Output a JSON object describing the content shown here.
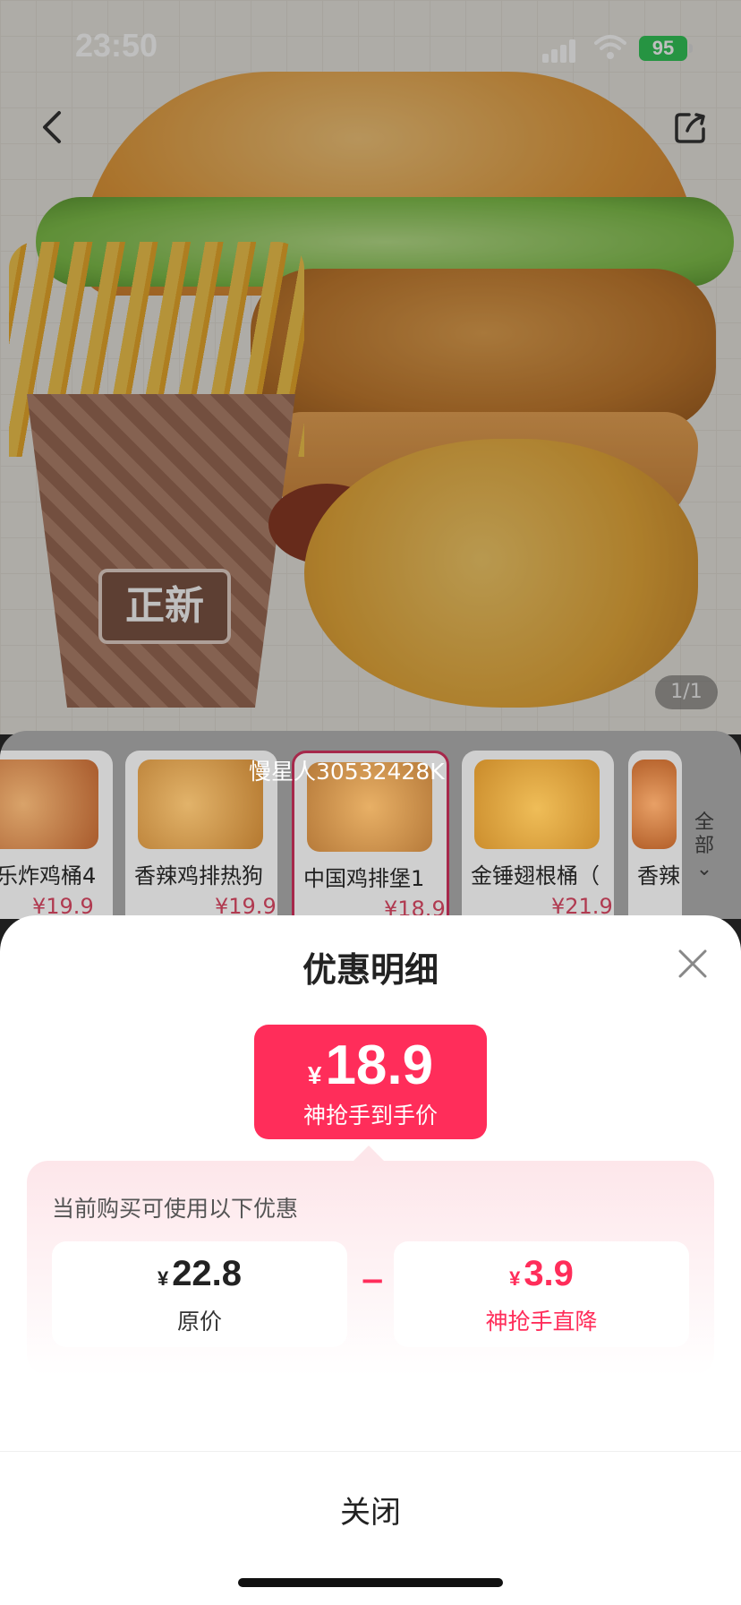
{
  "status": {
    "time": "23:50",
    "battery": "95"
  },
  "hero": {
    "pager": "1/1",
    "cup_brand": "正新"
  },
  "products": [
    {
      "name": "乐炸鸡桶4",
      "price": "¥19.9"
    },
    {
      "name": "香辣鸡排热狗",
      "price": "¥19.9"
    },
    {
      "name": "中国鸡排堡1",
      "price": "¥18.9"
    },
    {
      "name": "金锤翅根桶（",
      "price": "¥21.9"
    },
    {
      "name": "香辣",
      "price": ""
    }
  ],
  "all_button": "全部",
  "watermark": "慢星人30532428K",
  "sheet": {
    "title": "优惠明细",
    "final_price": {
      "currency": "¥",
      "value": "18.9",
      "label": "神抢手到手价"
    },
    "promo_label": "当前购买可使用以下优惠",
    "original": {
      "currency": "¥",
      "value": "22.8",
      "label": "原价"
    },
    "operator": "−",
    "discount": {
      "currency": "¥",
      "value": "3.9",
      "label": "神抢手直降"
    },
    "close_label": "关闭"
  },
  "colors": {
    "accent": "#ff2d5a",
    "battery": "#33c659"
  }
}
